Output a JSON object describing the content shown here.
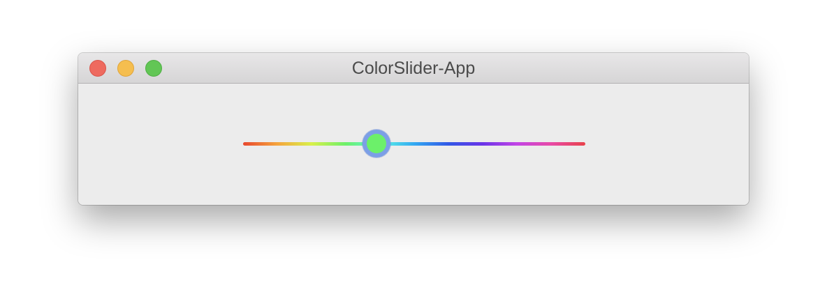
{
  "window": {
    "title": "ColorSlider-App"
  },
  "traffic_lights": {
    "close": "#ee6a5f",
    "minimize": "#f5be4f",
    "zoom": "#62c655"
  },
  "slider": {
    "value": 0.39,
    "thumb_color": "#6cf06a",
    "focus_ring_color": "#7c9fe6",
    "track_colors": [
      "#e8472e",
      "#f5a43d",
      "#d8f04a",
      "#6cf06a",
      "#5ef5e4",
      "#33a9f2",
      "#3158e6",
      "#6a34e8",
      "#c244e6",
      "#e84aa6",
      "#e8424a"
    ]
  }
}
